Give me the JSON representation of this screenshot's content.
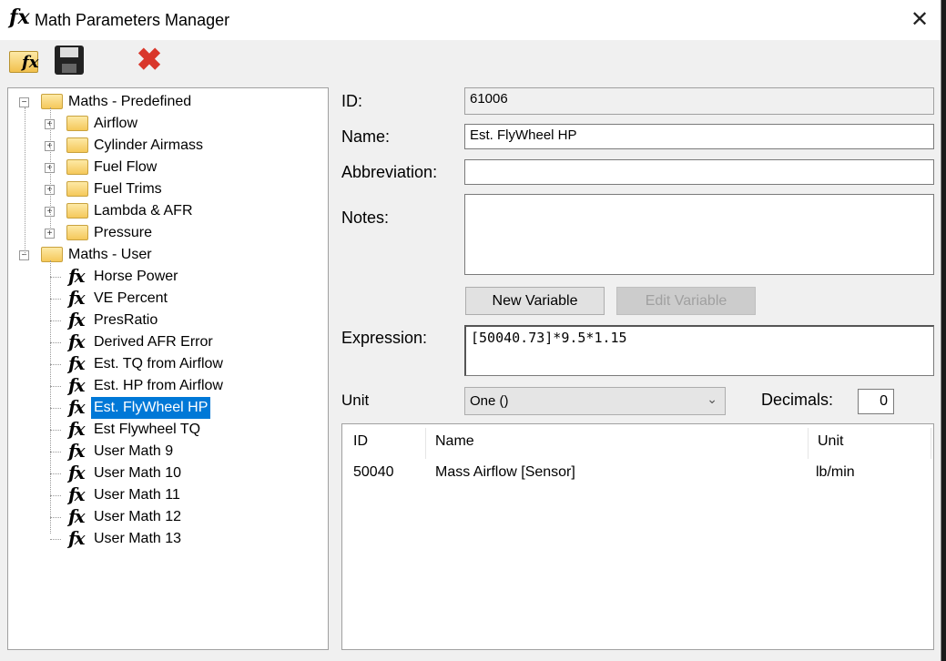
{
  "window": {
    "title": "Math Parameters Manager",
    "title_icon": "fx-icon"
  },
  "toolbar": {
    "icons": [
      "open-fx-folder-icon",
      "save-icon",
      "delete-icon"
    ]
  },
  "tree": {
    "groups": [
      {
        "label": "Maths - Predefined",
        "expanded": true,
        "children": [
          "Airflow",
          "Cylinder Airmass",
          "Fuel Flow",
          "Fuel Trims",
          "Lambda & AFR",
          "Pressure"
        ]
      },
      {
        "label": "Maths - User",
        "expanded": true,
        "children": [
          "Horse Power",
          "VE Percent",
          "PresRatio",
          "Derived AFR Error",
          "Est. TQ from Airflow",
          "Est. HP from Airflow",
          "Est. FlyWheel HP",
          "Est Flywheel TQ",
          "User Math 9",
          "User Math 10",
          "User Math 11",
          "User Math 12",
          "User Math 13"
        ]
      }
    ],
    "selected": "Est. FlyWheel HP"
  },
  "form": {
    "id_label": "ID:",
    "id_value": "61006",
    "name_label": "Name:",
    "name_value": "Est. FlyWheel HP",
    "abbrev_label": "Abbreviation:",
    "abbrev_value": "",
    "notes_label": "Notes:",
    "notes_value": "",
    "new_variable": "New Variable",
    "edit_variable": "Edit Variable",
    "expression_label": "Expression:",
    "expression_value": "[50040.73]*9.5*1.15",
    "unit_label": "Unit",
    "unit_value": "One ()",
    "decimals_label": "Decimals:",
    "decimals_value": "0"
  },
  "variables": {
    "columns": [
      "ID",
      "Name",
      "Unit"
    ],
    "rows": [
      {
        "id": "50040",
        "name": "Mass Airflow [Sensor]",
        "unit": "lb/min"
      }
    ]
  }
}
